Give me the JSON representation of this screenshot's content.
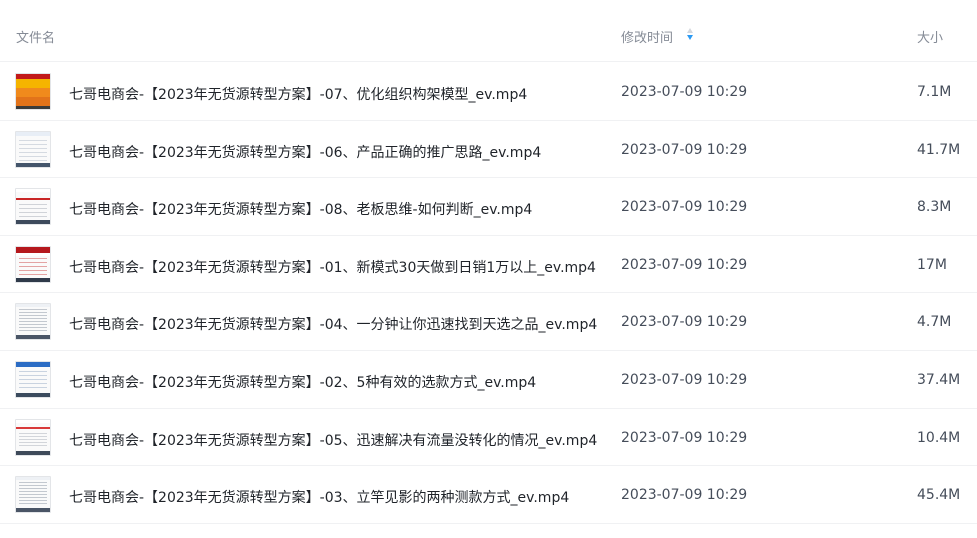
{
  "header": {
    "name_label": "文件名",
    "time_label": "修改时间",
    "size_label": "大小",
    "sort_icon": "sort-descending-icon"
  },
  "colors": {
    "sort_active": "#2b9af3",
    "divider": "#f0f1f3"
  },
  "files": [
    {
      "name": "七哥电商会-【2023年无货源转型方案】-07、优化组织构架模型_ev.mp4",
      "time": "2023-07-09 10:29",
      "size": "7.1M",
      "thumb": "orange"
    },
    {
      "name": "七哥电商会-【2023年无货源转型方案】-06、产品正确的推广思路_ev.mp4",
      "time": "2023-07-09 10:29",
      "size": "41.7M",
      "thumb": "light"
    },
    {
      "name": "七哥电商会-【2023年无货源转型方案】-08、老板思维-如何判断_ev.mp4",
      "time": "2023-07-09 10:29",
      "size": "8.3M",
      "thumb": "redline"
    },
    {
      "name": "七哥电商会-【2023年无货源转型方案】-01、新模式30天做到日销1万以上_ev.mp4",
      "time": "2023-07-09 10:29",
      "size": "17M",
      "thumb": "red"
    },
    {
      "name": "七哥电商会-【2023年无货源转型方案】-04、一分钟让你迅速找到天选之品_ev.mp4",
      "time": "2023-07-09 10:29",
      "size": "4.7M",
      "thumb": "table"
    },
    {
      "name": "七哥电商会-【2023年无货源转型方案】-02、5种有效的选款方式_ev.mp4",
      "time": "2023-07-09 10:29",
      "size": "37.4M",
      "thumb": "blue"
    },
    {
      "name": "七哥电商会-【2023年无货源转型方案】-05、迅速解决有流量没转化的情况_ev.mp4",
      "time": "2023-07-09 10:29",
      "size": "10.4M",
      "thumb": "redtext"
    },
    {
      "name": "七哥电商会-【2023年无货源转型方案】-03、立竿见影的两种测款方式_ev.mp4",
      "time": "2023-07-09 10:29",
      "size": "45.4M",
      "thumb": "table"
    }
  ]
}
